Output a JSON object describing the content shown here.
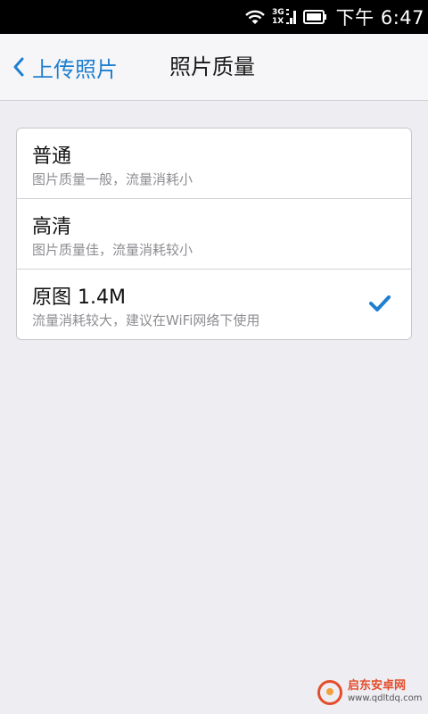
{
  "status_bar": {
    "network_top": "3G",
    "network_bottom": "1X",
    "time": "下午 6:47",
    "icons": [
      "wifi-icon",
      "signal-icon",
      "battery-icon"
    ]
  },
  "nav": {
    "back_label": "上传照片",
    "title": "照片质量",
    "accent_color": "#1f7fd0"
  },
  "options": [
    {
      "title": "普通",
      "description": "图片质量一般，流量消耗小",
      "selected": false
    },
    {
      "title": "高清",
      "description": "图片质量佳，流量消耗较小",
      "selected": false
    },
    {
      "title": "原图 1.4M",
      "description": "流量消耗较大，建议在WiFi网络下使用",
      "selected": true
    }
  ],
  "watermark": {
    "name": "启东安卓网",
    "url": "www.qdltdq.com"
  }
}
